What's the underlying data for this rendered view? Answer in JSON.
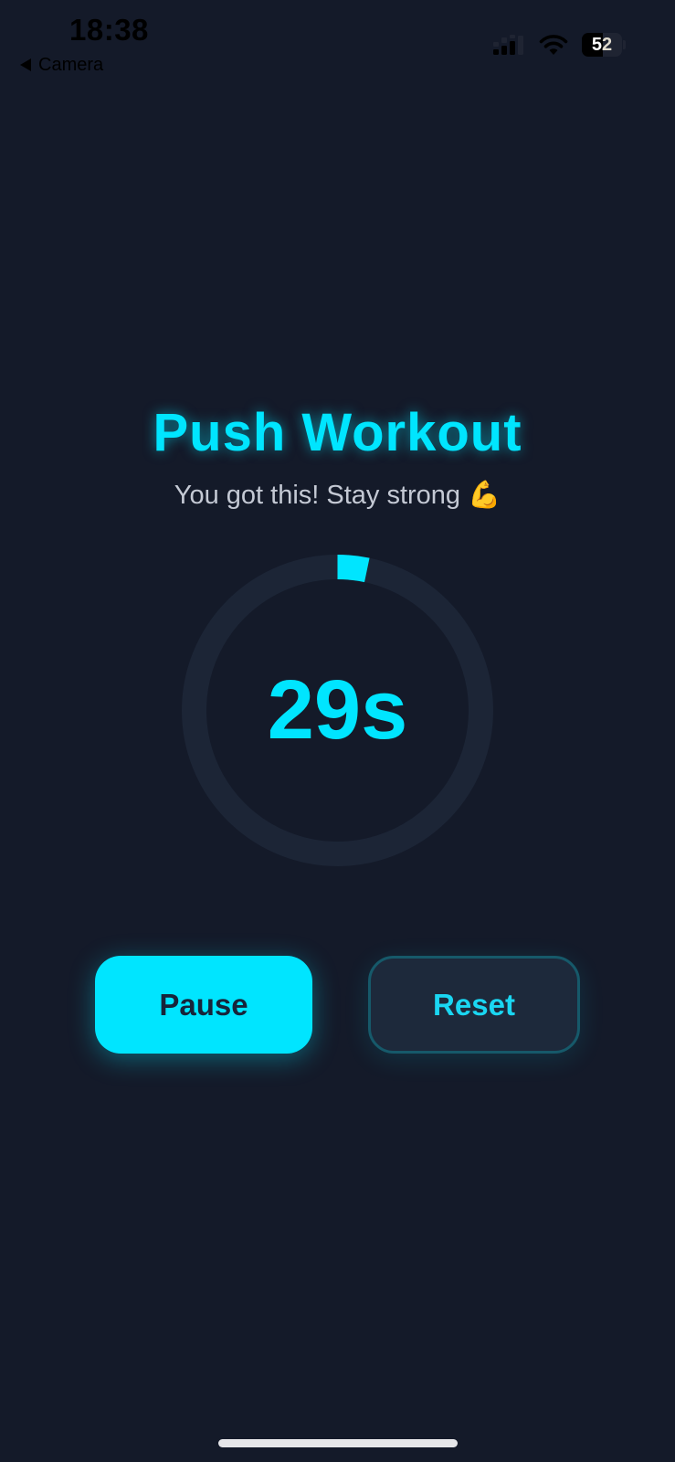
{
  "status_bar": {
    "time": "18:38",
    "back_label": "Camera",
    "battery": {
      "level_text": "52",
      "level_fraction": 0.52
    },
    "icons": [
      "signal-icon",
      "wifi-icon",
      "battery-icon",
      "back-arrow-icon"
    ]
  },
  "workout": {
    "title": "Push Workout",
    "subtitle": "You got this! Stay strong 💪",
    "timer_text": "29s",
    "progress": {
      "fraction": 0.033,
      "ring_color": "#1c2536",
      "progress_color": "#00e5ff"
    }
  },
  "controls": {
    "pause_label": "Pause",
    "reset_label": "Reset"
  },
  "colors": {
    "background": "#141a29",
    "accent": "#00e5ff",
    "subtitle": "#c4c9d4"
  }
}
